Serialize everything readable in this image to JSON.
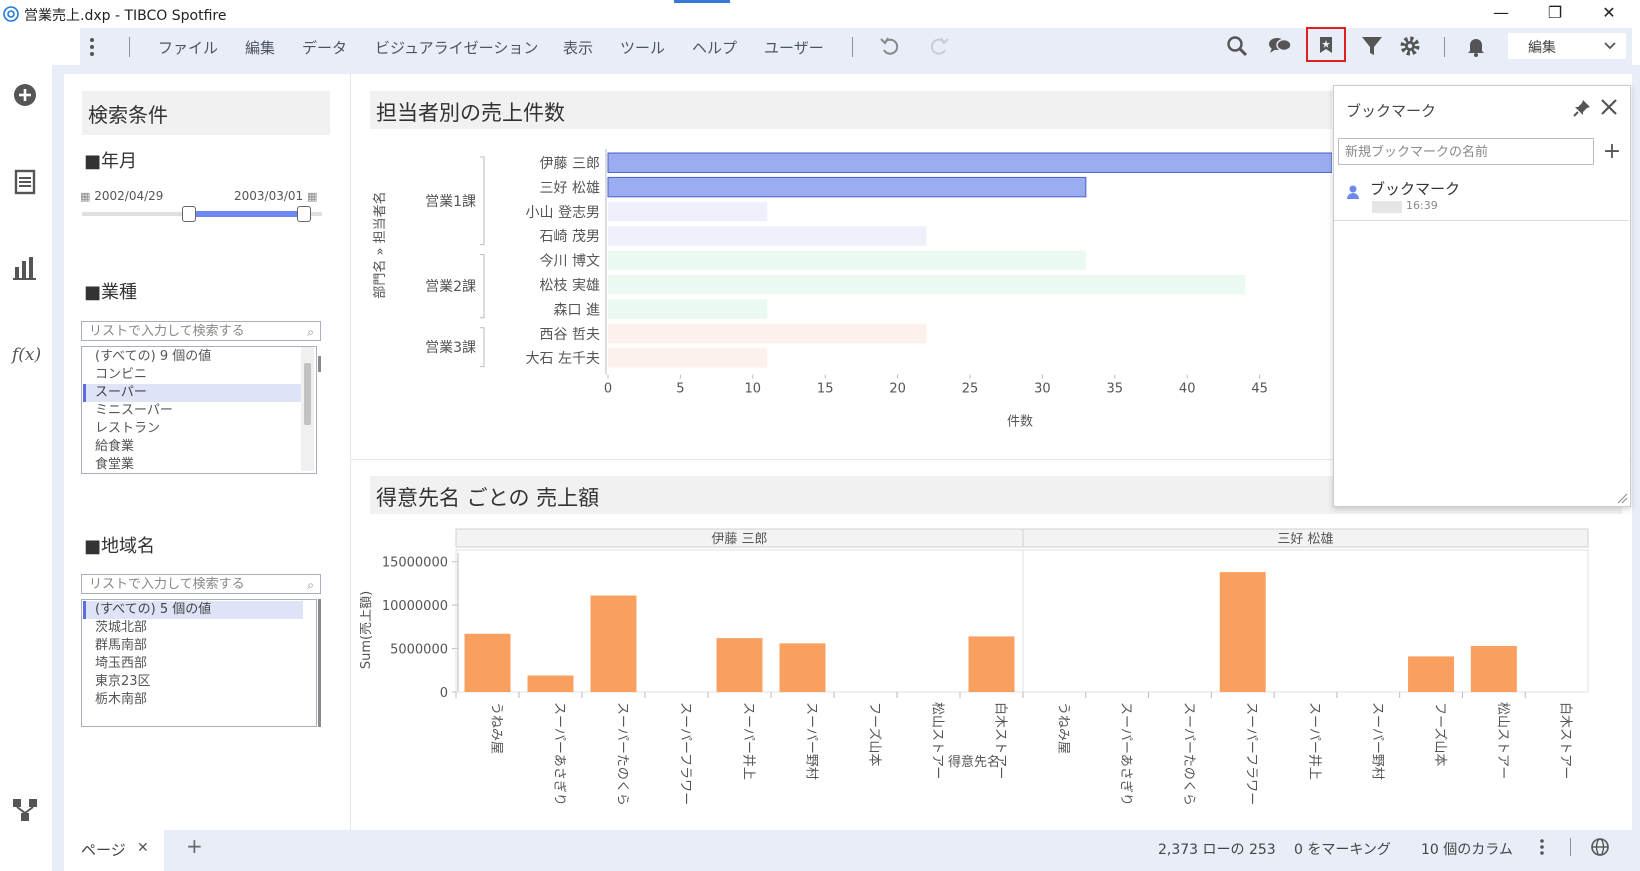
{
  "window": {
    "title": "営業売上.dxp - TIBCO Spotfire",
    "minimize": "—",
    "maximize": "❐",
    "close": "✕"
  },
  "menubar": {
    "items": [
      "ファイル",
      "編集",
      "データ",
      "ビジュアライゼーション",
      "表示",
      "ツール",
      "ヘルプ",
      "ユーザー"
    ],
    "mode_label": "編集"
  },
  "filter_panel": {
    "title": "検索条件",
    "year_month": {
      "header": "■年月",
      "from": "2002/04/29",
      "to": "2003/03/01",
      "range_fraction": [
        0.48,
        1.0
      ]
    },
    "industry": {
      "header": "■業種",
      "search_placeholder": "リストで入力して検索する",
      "items": [
        "(すべての) 9 個の値",
        "コンビニ",
        "スーパー",
        "ミニスーパー",
        "レストラン",
        "給食業",
        "食堂業"
      ],
      "selected_index": 2
    },
    "region": {
      "header": "■地域名",
      "search_placeholder": "リストで入力して検索する",
      "items": [
        "(すべての) 5 個の値",
        "茨城北部",
        "群馬南部",
        "埼玉西部",
        "東京23区",
        "栃木南部"
      ],
      "selected_index": 0
    }
  },
  "chart1": {
    "title": "担当者別の売上件数",
    "y_axis_label": "部門名 » 担当者名",
    "x_axis_label": "件数",
    "x_ticks": [
      "0",
      "5",
      "10",
      "15",
      "20",
      "25",
      "30",
      "35",
      "40",
      "45"
    ],
    "groups": [
      "営業1課",
      "営業2課",
      "営業3課"
    ]
  },
  "chart2": {
    "title": "得意先名 ごとの 売上額",
    "y_axis_label": "Sum(売上額)",
    "x_axis_label": "得意先名",
    "panels": [
      "伊藤 三郎",
      "三好 松雄"
    ],
    "y_ticks": [
      "15000000",
      "10000000",
      "5000000",
      "0"
    ]
  },
  "chart_data": [
    {
      "type": "bar",
      "orientation": "horizontal",
      "title": "担当者別の売上件数",
      "xlabel": "件数",
      "ylabel": "部門名 » 担当者名",
      "xlim": [
        0,
        50
      ],
      "categories": [
        {
          "group": "営業1課",
          "name": "伊藤 三郎",
          "value": 50
        },
        {
          "group": "営業1課",
          "name": "三好 松雄",
          "value": 33
        },
        {
          "group": "営業1課",
          "name": "小山 登志男",
          "value": 11
        },
        {
          "group": "営業1課",
          "name": "石崎 茂男",
          "value": 22
        },
        {
          "group": "営業2課",
          "name": "今川 博文",
          "value": 33
        },
        {
          "group": "営業2課",
          "name": "松枝 実雄",
          "value": 44
        },
        {
          "group": "営業2課",
          "name": "森口 進",
          "value": 11
        },
        {
          "group": "営業3課",
          "name": "西谷 哲夫",
          "value": 22
        },
        {
          "group": "営業3課",
          "name": "大石 左千夫",
          "value": 11
        }
      ],
      "colors": {
        "営業1課_marked": "#9badf0",
        "営業1課": "#eef0fb",
        "営業2課": "#eafaf0",
        "営業3課": "#fdf1eb"
      }
    },
    {
      "type": "bar",
      "title": "得意先名 ごとの 売上額",
      "xlabel": "得意先名",
      "ylabel": "Sum(売上額)",
      "ylim": [
        0,
        16000000
      ],
      "categories": [
        "うねみ屋",
        "スーパーあさぎり",
        "スーパーたのくら",
        "スーパーフラワー",
        "スーパー井上",
        "スーパー野村",
        "フーズ山本",
        "松山ストアー",
        "白木ストアー"
      ],
      "series": [
        {
          "name": "伊藤 三郎",
          "values": [
            6700000,
            1900000,
            11100000,
            0,
            6200000,
            5600000,
            0,
            0,
            6400000
          ]
        },
        {
          "name": "三好 松雄",
          "values": [
            0,
            0,
            0,
            13800000,
            0,
            0,
            4100000,
            5300000,
            0
          ]
        }
      ],
      "color": "#f9a060"
    }
  ],
  "bookmark_panel": {
    "title": "ブックマーク",
    "new_name_placeholder": "新規ブックマークの名前",
    "add_label": "+",
    "item_name": "ブックマーク",
    "item_time": "16:39"
  },
  "bottombar": {
    "page_tab": "ページ",
    "add_page": "+",
    "rows": "2,373 ローの 253",
    "marked": "0 をマーキング",
    "columns": "10 個のカラム"
  }
}
